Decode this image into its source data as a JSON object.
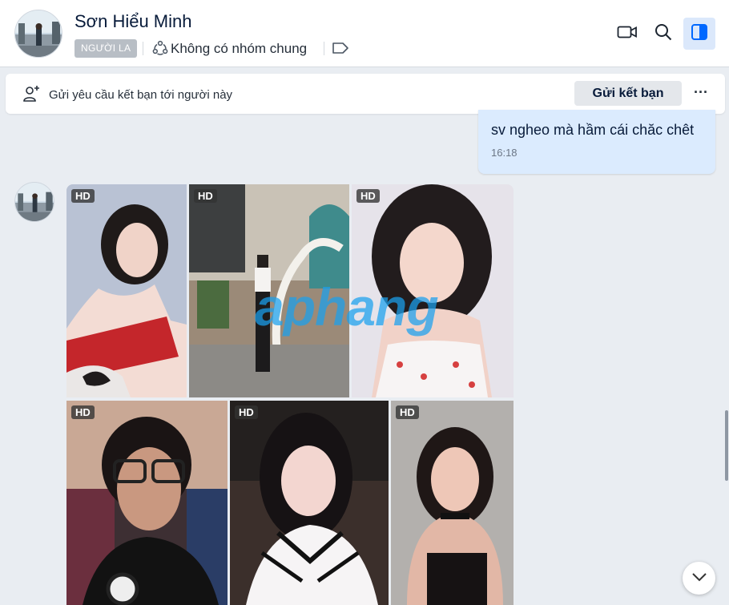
{
  "contact": {
    "name": "Sơn Hiểu Minh",
    "badge": "NGƯỜI LA",
    "groups_text": "Không có nhóm chung"
  },
  "header_actions": [
    {
      "name": "video-call",
      "icon": "video-camera-icon"
    },
    {
      "name": "search",
      "icon": "search-icon"
    },
    {
      "name": "toggle-info-panel",
      "icon": "sidebar-panel-icon"
    }
  ],
  "friend_request": {
    "text": "Gửi yêu cầu kết bạn tới người này",
    "button_label": "Gửi kết bạn",
    "more_label": "···"
  },
  "message": {
    "text": "sv ngheo mà hầm cái chăc chêt",
    "time": "16:18"
  },
  "photos": [
    {
      "badge": "HD"
    },
    {
      "badge": "HD"
    },
    {
      "badge": "HD"
    },
    {
      "badge": "HD"
    },
    {
      "badge": "HD"
    },
    {
      "badge": "HD"
    }
  ],
  "watermark": "aphang",
  "colors": {
    "accent": "#0068ff",
    "bubble": "#dbebfe",
    "background": "#e9edf2"
  }
}
